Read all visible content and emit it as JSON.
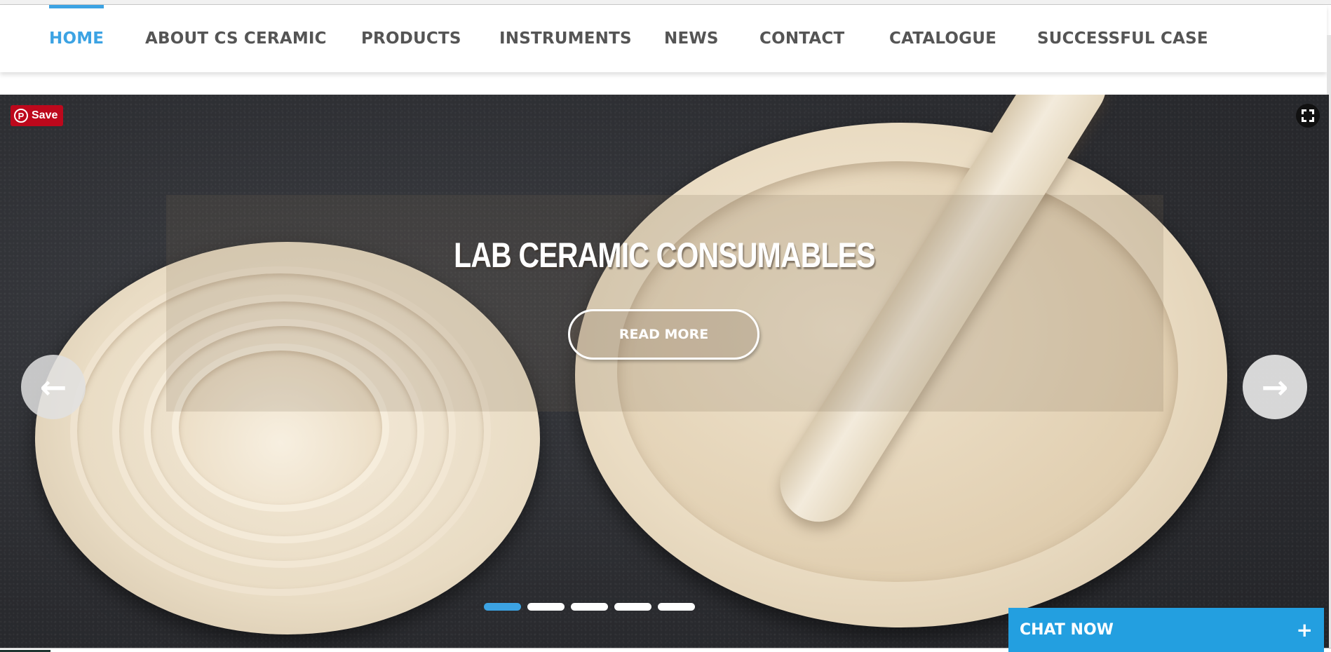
{
  "nav": {
    "items": [
      {
        "label": "HOME",
        "active": true
      },
      {
        "label": "ABOUT CS CERAMIC",
        "active": false
      },
      {
        "label": "PRODUCTS",
        "active": false
      },
      {
        "label": "INSTRUMENTS",
        "active": false
      },
      {
        "label": "NEWS",
        "active": false
      },
      {
        "label": "CONTACT",
        "active": false
      },
      {
        "label": "CATALOGUE",
        "active": false
      },
      {
        "label": "SUCCESSFUL CASE",
        "active": false
      }
    ]
  },
  "hero": {
    "title": "LAB CERAMIC CONSUMABLES",
    "button_label": "READ MORE",
    "prev_icon": "←",
    "next_icon": "→",
    "slides_total": 5,
    "active_slide": 1
  },
  "pinterest": {
    "icon": "P",
    "label": "Save"
  },
  "chat": {
    "label": "CHAT NOW",
    "plus_icon": "+"
  },
  "colors": {
    "accent": "#3ca3e3",
    "chat_bg": "#239fe0",
    "pinterest_red": "#bd081c",
    "nav_text": "#555555"
  }
}
